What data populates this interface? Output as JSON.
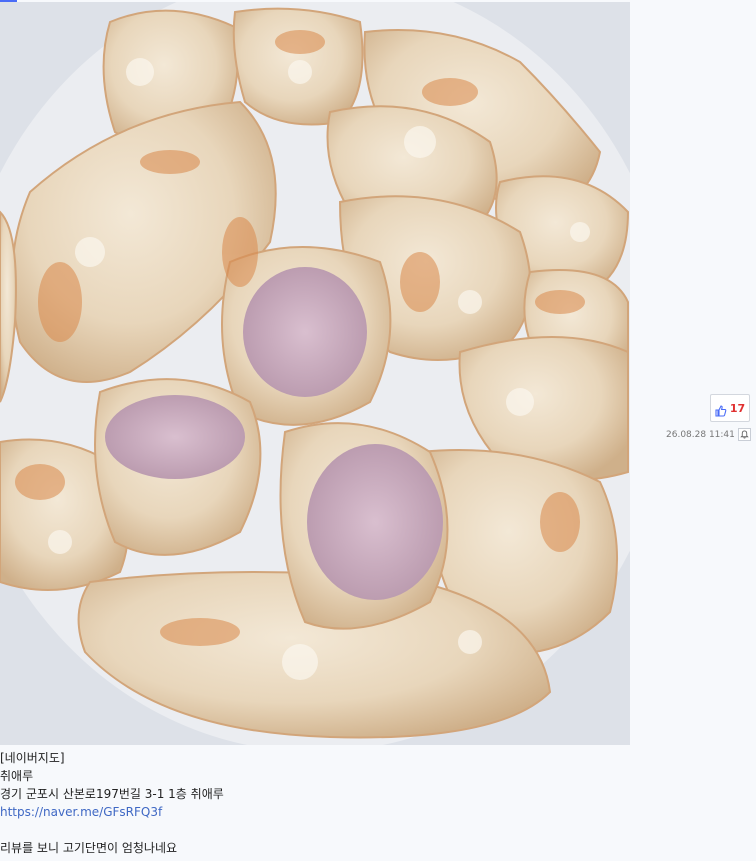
{
  "post": {
    "image_alt": "fried pieces with pink filling",
    "vote_count": "17",
    "timestamp": "26.08.28 11:41",
    "content": {
      "line1": "[네이버지도]",
      "line2": "취애루",
      "line3": "경기 군포시 산본로197번길 3-1 1층 취애루",
      "link": "https://naver.me/GFsRFQ3f",
      "line5": "리뷰를 보니 고기단면이 엄청나네요"
    }
  },
  "icons": {
    "vote": "thumbs-up-icon",
    "notify": "bell-icon"
  },
  "colors": {
    "vote_count": "#e03131",
    "link": "#3f68c4",
    "thumb": "#4a6cf7"
  }
}
